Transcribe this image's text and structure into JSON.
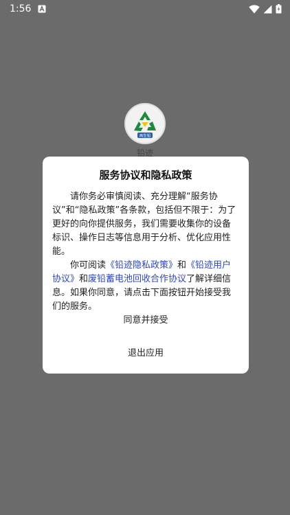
{
  "status_bar": {
    "time": "1:56"
  },
  "app": {
    "name": "铅迹",
    "logo_text": "再生铅"
  },
  "dialog": {
    "title": "服务协议和隐私政策",
    "para1": "请你务必审慎阅读、充分理解“服务协议”和“隐私政策”各条款，包括但不限于：为了更好的向你提供服务，我们需要收集你的设备标识、操作日志等信息用于分析、优化应用性能。",
    "para2_prefix": "你可阅读",
    "privacy_link": "《铅迹隐私政策》",
    "and1": "和",
    "user_link": "《铅迹用户协议》",
    "and2": "和",
    "recycle_link": "废铅蓄电池回收合作协议",
    "para2_suffix": "了解详细信息。如果你同意，请点击下面按钮开始接受我们的服务。",
    "agree_label": "同意并接受",
    "exit_label": "退出应用"
  },
  "colors": {
    "link": "#2d46c9",
    "scrim": "#6b6b6b",
    "logo_green": "#1e8a3e"
  }
}
